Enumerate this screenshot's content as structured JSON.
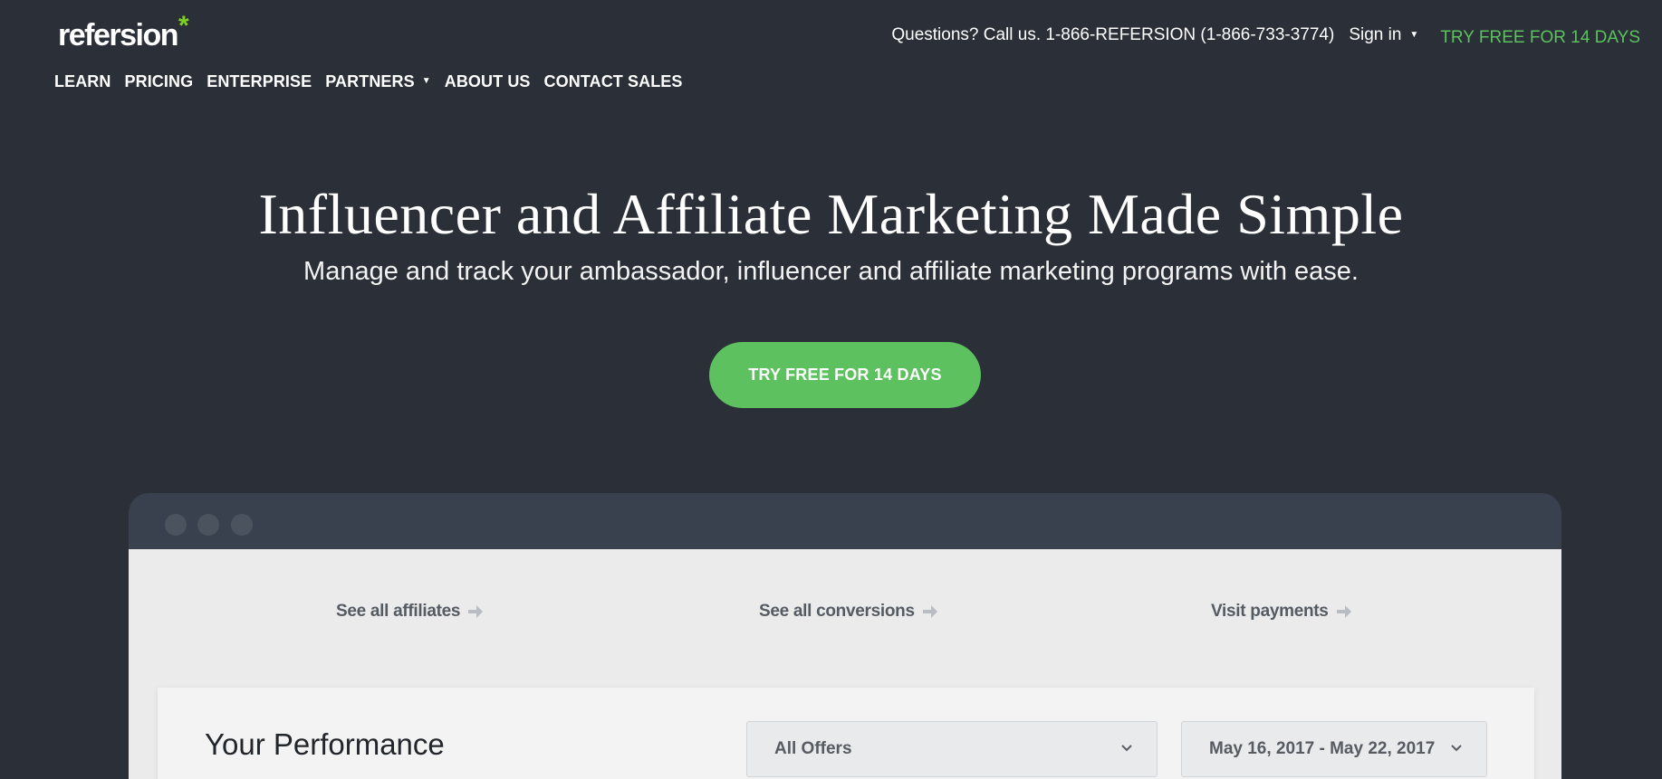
{
  "header": {
    "logo_text": "refersion",
    "logo_star": "*",
    "phone_text": "Questions? Call us. 1-866-REFERSION (1-866-733-3774)",
    "signin_label": "Sign in",
    "try_link_label": "TRY FREE FOR 14 DAYS"
  },
  "nav": {
    "items": [
      "LEARN",
      "PRICING",
      "ENTERPRISE",
      "PARTNERS",
      "ABOUT US",
      "CONTACT SALES"
    ]
  },
  "hero": {
    "title": "Influencer and Affiliate Marketing Made Simple",
    "subtitle": "Manage and track your ambassador, influencer and affiliate marketing programs with ease.",
    "cta_label": "TRY FREE FOR 14 DAYS"
  },
  "mockup": {
    "quick_links": [
      "See all affiliates",
      "See all conversions",
      "Visit payments"
    ],
    "performance": {
      "title": "Your Performance",
      "offers_select": "All Offers",
      "date_select": "May 16, 2017 - May 22, 2017"
    }
  },
  "colors": {
    "background": "#2a2f38",
    "accent_green": "#5cc15e",
    "logo_star": "#7ed321",
    "mock_titlebar": "#38414d",
    "mock_body": "#ebebeb"
  },
  "icons": {
    "caret": "caret-down-icon",
    "arrow": "arrow-right-icon",
    "chevron": "chevron-down-icon"
  }
}
